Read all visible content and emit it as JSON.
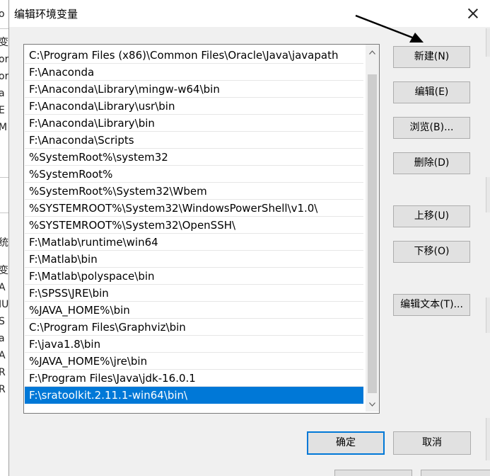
{
  "window": {
    "title": "编辑环境变量"
  },
  "paths": [
    "C:\\Program Files (x86)\\Common Files\\Oracle\\Java\\javapath",
    "F:\\Anaconda",
    "F:\\Anaconda\\Library\\mingw-w64\\bin",
    "F:\\Anaconda\\Library\\usr\\bin",
    "F:\\Anaconda\\Library\\bin",
    "F:\\Anaconda\\Scripts",
    "%SystemRoot%\\system32",
    "%SystemRoot%",
    "%SystemRoot%\\System32\\Wbem",
    "%SYSTEMROOT%\\System32\\WindowsPowerShell\\v1.0\\",
    "%SYSTEMROOT%\\System32\\OpenSSH\\",
    "F:\\Matlab\\runtime\\win64",
    "F:\\Matlab\\bin",
    "F:\\Matlab\\polyspace\\bin",
    "F:\\SPSS\\JRE\\bin",
    "%JAVA_HOME%\\bin",
    "C:\\Program Files\\Graphviz\\bin",
    "F:\\java1.8\\bin",
    "%JAVA_HOME%\\jre\\bin",
    "F:\\Program Files\\Java\\jdk-16.0.1",
    "F:\\sratoolkit.2.11.1-win64\\bin\\"
  ],
  "selected_index": 20,
  "buttons": {
    "new": "新建(N)",
    "edit": "编辑(E)",
    "browse": "浏览(B)...",
    "delete": "删除(D)",
    "move_up": "上移(U)",
    "move_down": "下移(O)",
    "edit_text": "编辑文本(T)...",
    "ok": "确定",
    "cancel": "取消"
  },
  "background_fragments": [
    "o",
    "变",
    "or",
    "or",
    "a",
    "E",
    "M",
    "统",
    "变",
    "A",
    "IU",
    "S",
    "a",
    "A",
    "R",
    "R"
  ],
  "colors": {
    "selection": "#0078d7",
    "dialog_bg": "#f0f0f0",
    "button_bg": "#e1e1e1"
  }
}
